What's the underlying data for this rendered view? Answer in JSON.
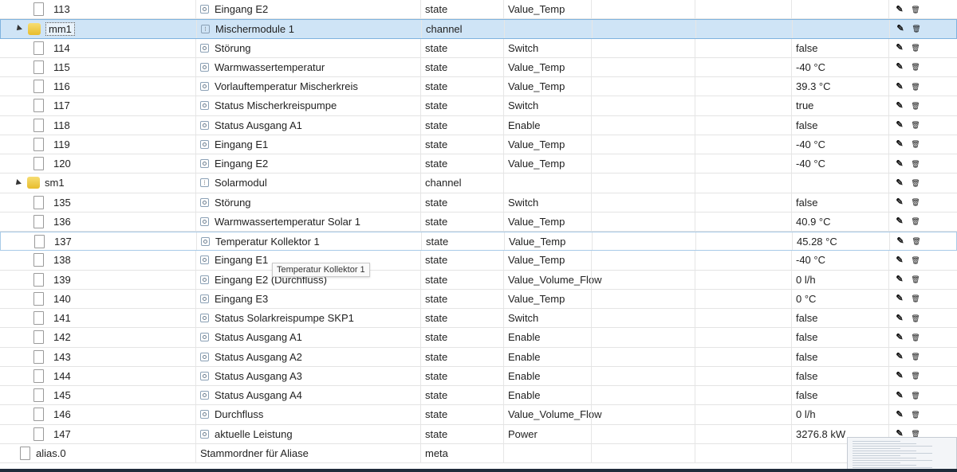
{
  "rows": [
    {
      "id": "113",
      "name": "Eingang E2",
      "type": "state",
      "role": "Value_Temp",
      "value": "",
      "kind": "file",
      "icon": "state-icon"
    },
    {
      "id": "mm1",
      "name": "Mischermodule 1",
      "type": "channel",
      "role": "",
      "value": "",
      "kind": "folder",
      "icon": "channel-icon"
    },
    {
      "id": "114",
      "name": "Störung",
      "type": "state",
      "role": "Switch",
      "value": "false",
      "kind": "file",
      "icon": "state-icon"
    },
    {
      "id": "115",
      "name": "Warmwassertemperatur",
      "type": "state",
      "role": "Value_Temp",
      "value": "-40 °C",
      "kind": "file",
      "icon": "state-icon"
    },
    {
      "id": "116",
      "name": "Vorlauftemperatur Mischerkreis",
      "type": "state",
      "role": "Value_Temp",
      "value": "39.3 °C",
      "kind": "file",
      "icon": "state-icon"
    },
    {
      "id": "117",
      "name": "Status Mischerkreispumpe",
      "type": "state",
      "role": "Switch",
      "value": "true",
      "kind": "file",
      "icon": "state-icon"
    },
    {
      "id": "118",
      "name": "Status Ausgang A1",
      "type": "state",
      "role": "Enable",
      "value": "false",
      "kind": "file",
      "icon": "state-icon"
    },
    {
      "id": "119",
      "name": "Eingang E1",
      "type": "state",
      "role": "Value_Temp",
      "value": "-40 °C",
      "kind": "file",
      "icon": "state-icon"
    },
    {
      "id": "120",
      "name": "Eingang E2",
      "type": "state",
      "role": "Value_Temp",
      "value": "-40 °C",
      "kind": "file",
      "icon": "state-icon"
    },
    {
      "id": "sm1",
      "name": "Solarmodul",
      "type": "channel",
      "role": "",
      "value": "",
      "kind": "folder",
      "icon": "channel-icon"
    },
    {
      "id": "135",
      "name": "Störung",
      "type": "state",
      "role": "Switch",
      "value": "false",
      "kind": "file",
      "icon": "state-icon"
    },
    {
      "id": "136",
      "name": "Warmwassertemperatur Solar 1",
      "type": "state",
      "role": "Value_Temp",
      "value": "40.9 °C",
      "kind": "file",
      "icon": "state-icon"
    },
    {
      "id": "137",
      "name": "Temperatur Kollektor 1",
      "type": "state",
      "role": "Value_Temp",
      "value": "45.28 °C",
      "kind": "file",
      "icon": "state-icon"
    },
    {
      "id": "138",
      "name": "Eingang E1",
      "type": "state",
      "role": "Value_Temp",
      "value": "-40 °C",
      "kind": "file",
      "icon": "state-icon"
    },
    {
      "id": "139",
      "name": "Eingang E2 (Durchfluss)",
      "type": "state",
      "role": "Value_Volume_Flow",
      "value": "0 l/h",
      "kind": "file",
      "icon": "state-icon"
    },
    {
      "id": "140",
      "name": "Eingang E3",
      "type": "state",
      "role": "Value_Temp",
      "value": "0 °C",
      "kind": "file",
      "icon": "state-icon"
    },
    {
      "id": "141",
      "name": "Status Solarkreispumpe SKP1",
      "type": "state",
      "role": "Switch",
      "value": "false",
      "kind": "file",
      "icon": "state-icon"
    },
    {
      "id": "142",
      "name": "Status Ausgang A1",
      "type": "state",
      "role": "Enable",
      "value": "false",
      "kind": "file",
      "icon": "state-icon"
    },
    {
      "id": "143",
      "name": "Status Ausgang A2",
      "type": "state",
      "role": "Enable",
      "value": "false",
      "kind": "file",
      "icon": "state-icon"
    },
    {
      "id": "144",
      "name": "Status Ausgang A3",
      "type": "state",
      "role": "Enable",
      "value": "false",
      "kind": "file",
      "icon": "state-icon"
    },
    {
      "id": "145",
      "name": "Status Ausgang A4",
      "type": "state",
      "role": "Enable",
      "value": "false",
      "kind": "file",
      "icon": "state-icon"
    },
    {
      "id": "146",
      "name": "Durchfluss",
      "type": "state",
      "role": "Value_Volume_Flow",
      "value": "0 l/h",
      "kind": "file",
      "icon": "state-icon"
    },
    {
      "id": "147",
      "name": "aktuelle Leistung",
      "type": "state",
      "role": "Power",
      "value": "3276.8 kW",
      "kind": "file",
      "icon": "state-icon"
    },
    {
      "id": "alias.0",
      "name": "Stammordner für Aliase",
      "type": "meta",
      "role": "",
      "value": "",
      "kind": "file-root",
      "icon": ""
    }
  ],
  "tooltip": "Temperatur Kollektor 1",
  "icons": {
    "edit": "pencil-icon",
    "delete": "trash-icon"
  },
  "colors": {
    "selected_row": "#cfe4f6",
    "folder": "#e8bd2d"
  }
}
